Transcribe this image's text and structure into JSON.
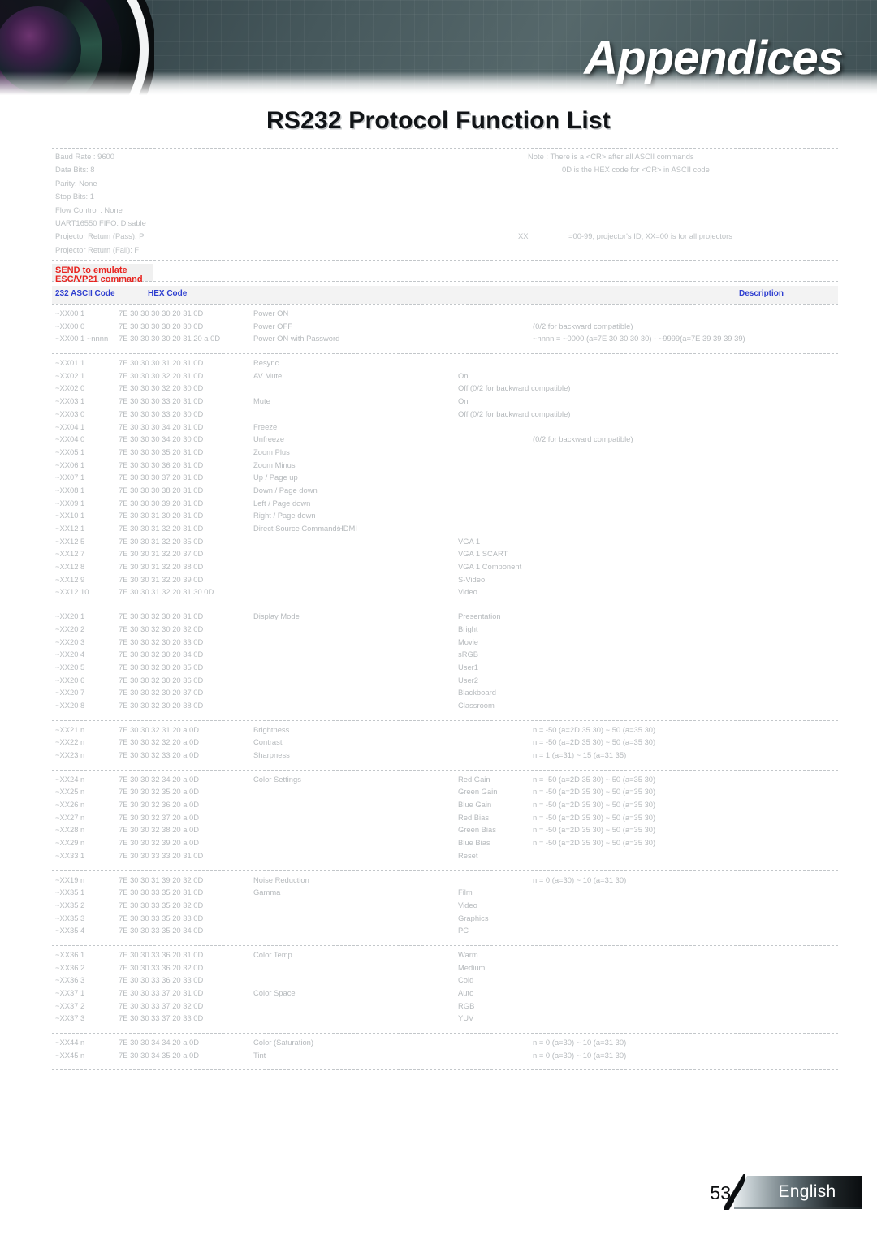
{
  "banner": {
    "title": "Appendices",
    "lens_icon": "camera-lens-icon"
  },
  "page_title": "RS232 Protocol Function List",
  "spec": {
    "labels": [
      "Baud Rate : 9600",
      "Data Bits: 8",
      "Parity: None",
      "Stop Bits: 1",
      "Flow Control : None",
      "UART16550 FIFO: Disable",
      "Projector Return (Pass): P",
      "Projector Return (Fail): F"
    ],
    "note_1": "Note : There is a <CR> after all ASCII commands",
    "note_2": "0D is the HEX code for <CR> in ASCII code",
    "xx_label": "XX",
    "xx_value": "=00-99, projector's ID, XX=00 is for all projectors"
  },
  "red_band": "SEND to emulate ESC/VP21 command",
  "column_header": {
    "a": "232 ASCII Code",
    "b": "HEX Code",
    "c": "Description"
  },
  "groups": [
    {
      "name": "power",
      "rows": [
        {
          "id": "~XX00 1",
          "hex": "7E 30 30 30 30 20 31 0D",
          "fn": "Power ON",
          "fn2": "",
          "val": "",
          "note": "",
          "note2": ""
        },
        {
          "id": "~XX00 0",
          "hex": "7E 30 30 30 30 20 30 0D",
          "fn": "Power OFF",
          "fn2": "",
          "val": "",
          "note": "(0/2 for backward compatible)",
          "note2": ""
        },
        {
          "id": "~XX00 1 ~nnnn",
          "hex": "7E 30 30 30 30 20 31 20 a 0D",
          "fn": "Power ON with Password",
          "fn2": "",
          "val": "",
          "note": "~nnnn = ~0000 (a=7E 30 30 30 30) - ~9999(a=7E 39 39 39 39)",
          "note2": ""
        }
      ]
    },
    {
      "name": "controls",
      "rows": [
        {
          "id": "~XX01 1",
          "hex": "7E 30 30 30 31 20 31 0D",
          "fn": "Resync",
          "fn2": "",
          "val": "",
          "note": "",
          "note2": ""
        },
        {
          "id": "~XX02 1",
          "hex": "7E 30 30 30 32 20 31 0D",
          "fn": "AV Mute",
          "fn2": "",
          "val": "On",
          "note": "",
          "note2": ""
        },
        {
          "id": "~XX02 0",
          "hex": "7E 30 30 30 32 20 30 0D",
          "fn": "",
          "fn2": "",
          "val": "Off (0/2 for backward compatible)",
          "note": "",
          "note2": ""
        },
        {
          "id": "~XX03 1",
          "hex": "7E 30 30 30 33 20 31 0D",
          "fn": "Mute",
          "fn2": "",
          "val": "On",
          "note": "",
          "note2": ""
        },
        {
          "id": "~XX03 0",
          "hex": "7E 30 30 30 33 20 30 0D",
          "fn": "",
          "fn2": "",
          "val": "Off (0/2 for backward compatible)",
          "note": "",
          "note2": ""
        },
        {
          "id": "~XX04 1",
          "hex": "7E 30 30 30 34 20 31 0D",
          "fn": "Freeze",
          "fn2": "",
          "val": "",
          "note": "",
          "note2": ""
        },
        {
          "id": "~XX04 0",
          "hex": "7E 30 30 30 34 20 30 0D",
          "fn": "Unfreeze",
          "fn2": "",
          "val": "",
          "note": "(0/2 for backward compatible)",
          "note2": ""
        },
        {
          "id": "~XX05 1",
          "hex": "7E 30 30 30 35 20 31 0D",
          "fn": "Zoom Plus",
          "fn2": "",
          "val": "",
          "note": "",
          "note2": ""
        },
        {
          "id": "~XX06 1",
          "hex": "7E 30 30 30 36 20 31 0D",
          "fn": "Zoom Minus",
          "fn2": "",
          "val": "",
          "note": "",
          "note2": ""
        },
        {
          "id": "~XX07 1",
          "hex": "7E 30 30 30 37 20 31 0D",
          "fn": "Up / Page up",
          "fn2": "",
          "val": "",
          "note": "",
          "note2": ""
        },
        {
          "id": "~XX08 1",
          "hex": "7E 30 30 30 38 20 31 0D",
          "fn": "Down / Page down",
          "fn2": "",
          "val": "",
          "note": "",
          "note2": ""
        },
        {
          "id": "~XX09 1",
          "hex": "7E 30 30 30 39 20 31 0D",
          "fn": "Left / Page down",
          "fn2": "",
          "val": "",
          "note": "",
          "note2": ""
        },
        {
          "id": "~XX10 1",
          "hex": "7E 30 30 31 30 20 31 0D",
          "fn": "Right / Page down",
          "fn2": "",
          "val": "",
          "note": "",
          "note2": ""
        },
        {
          "id": "~XX12 1",
          "hex": "7E 30 30 31 32 20 31 0D",
          "fn": "Direct Source Commands",
          "fn2": "HDMI",
          "val": "",
          "note": "",
          "note2": ""
        },
        {
          "id": "~XX12 5",
          "hex": "7E 30 30 31 32 20 35 0D",
          "fn": "",
          "fn2": "",
          "val": "VGA 1",
          "note": "",
          "note2": ""
        },
        {
          "id": "~XX12 7",
          "hex": "7E 30 30 31 32 20 37 0D",
          "fn": "",
          "fn2": "",
          "val": "VGA 1 SCART",
          "note": "",
          "note2": ""
        },
        {
          "id": "~XX12 8",
          "hex": "7E 30 30 31 32 20 38 0D",
          "fn": "",
          "fn2": "",
          "val": "VGA 1 Component",
          "note": "",
          "note2": ""
        },
        {
          "id": "~XX12 9",
          "hex": "7E 30 30 31 32 20 39 0D",
          "fn": "",
          "fn2": "",
          "val": "S-Video",
          "note": "",
          "note2": ""
        },
        {
          "id": "~XX12 10",
          "hex": "7E 30 30 31 32 20 31 30 0D",
          "fn": "",
          "fn2": "",
          "val": "Video",
          "note": "",
          "note2": ""
        }
      ]
    },
    {
      "name": "display-mode",
      "rows": [
        {
          "id": "~XX20 1",
          "hex": "7E 30 30 32 30 20 31 0D",
          "fn": "Display Mode",
          "fn2": "",
          "val": "Presentation",
          "note": "",
          "note2": ""
        },
        {
          "id": "~XX20 2",
          "hex": "7E 30 30 32 30 20 32 0D",
          "fn": "",
          "fn2": "",
          "val": "Bright",
          "note": "",
          "note2": ""
        },
        {
          "id": "~XX20 3",
          "hex": "7E 30 30 32 30 20 33 0D",
          "fn": "",
          "fn2": "",
          "val": "Movie",
          "note": "",
          "note2": ""
        },
        {
          "id": "~XX20 4",
          "hex": "7E 30 30 32 30 20 34 0D",
          "fn": "",
          "fn2": "",
          "val": "sRGB",
          "note": "",
          "note2": ""
        },
        {
          "id": "~XX20 5",
          "hex": "7E 30 30 32 30 20 35 0D",
          "fn": "",
          "fn2": "",
          "val": "User1",
          "note": "",
          "note2": ""
        },
        {
          "id": "~XX20 6",
          "hex": "7E 30 30 32 30 20 36 0D",
          "fn": "",
          "fn2": "",
          "val": "User2",
          "note": "",
          "note2": ""
        },
        {
          "id": "~XX20 7",
          "hex": "7E 30 30 32 30 20 37 0D",
          "fn": "",
          "fn2": "",
          "val": "Blackboard",
          "note": "",
          "note2": ""
        },
        {
          "id": "~XX20 8",
          "hex": "7E 30 30 32 30 20 38 0D",
          "fn": "",
          "fn2": "",
          "val": "Classroom",
          "note": "",
          "note2": ""
        }
      ]
    },
    {
      "name": "image-adjust",
      "rows": [
        {
          "id": "~XX21 n",
          "hex": "7E 30 30 32 31 20 a 0D",
          "fn": "Brightness",
          "fn2": "",
          "val": "",
          "note": "n = -50 (a=2D 35 30) ~ 50 (a=35 30)",
          "note2": ""
        },
        {
          "id": "~XX22 n",
          "hex": "7E 30 30 32 32 20 a 0D",
          "fn": "Contrast",
          "fn2": "",
          "val": "",
          "note": "n = -50 (a=2D 35 30) ~ 50 (a=35 30)",
          "note2": ""
        },
        {
          "id": "~XX23 n",
          "hex": "7E 30 30 32 33 20 a 0D",
          "fn": "Sharpness",
          "fn2": "",
          "val": "",
          "note": "n = 1 (a=31) ~ 15 (a=31 35)",
          "note2": ""
        }
      ]
    },
    {
      "name": "color-settings",
      "rows": [
        {
          "id": "~XX24 n",
          "hex": "7E 30 30 32 34 20 a 0D",
          "fn": "Color Settings",
          "fn2": "",
          "val": "Red Gain",
          "note": "n = -50 (a=2D 35 30) ~ 50 (a=35 30)",
          "note2": ""
        },
        {
          "id": "~XX25 n",
          "hex": "7E 30 30 32 35 20 a 0D",
          "fn": "",
          "fn2": "",
          "val": "Green Gain",
          "note": "n = -50 (a=2D 35 30) ~ 50 (a=35 30)",
          "note2": ""
        },
        {
          "id": "~XX26 n",
          "hex": "7E 30 30 32 36 20 a 0D",
          "fn": "",
          "fn2": "",
          "val": "Blue Gain",
          "note": "n = -50 (a=2D 35 30) ~ 50 (a=35 30)",
          "note2": ""
        },
        {
          "id": "~XX27 n",
          "hex": "7E 30 30 32 37 20 a 0D",
          "fn": "",
          "fn2": "",
          "val": "Red Bias",
          "note": "n = -50 (a=2D 35 30) ~ 50 (a=35 30)",
          "note2": ""
        },
        {
          "id": "~XX28 n",
          "hex": "7E 30 30 32 38 20 a 0D",
          "fn": "",
          "fn2": "",
          "val": "Green Bias",
          "note": "n = -50 (a=2D 35 30) ~ 50 (a=35 30)",
          "note2": ""
        },
        {
          "id": "~XX29 n",
          "hex": "7E 30 30 32 39 20 a 0D",
          "fn": "",
          "fn2": "",
          "val": "Blue Bias",
          "note": "n = -50 (a=2D 35 30) ~ 50 (a=35 30)",
          "note2": ""
        },
        {
          "id": "~XX33 1",
          "hex": "7E 30 30 33 33 20 31 0D",
          "fn": "",
          "fn2": "",
          "val": "Reset",
          "note": "",
          "note2": ""
        }
      ]
    },
    {
      "name": "gamma",
      "rows": [
        {
          "id": "~XX19 n",
          "hex": "7E 30 30 31 39 20 32 0D",
          "fn": "Noise Reduction",
          "fn2": "",
          "val": "",
          "note": "n = 0 (a=30) ~ 10 (a=31 30)",
          "note2": ""
        },
        {
          "id": "~XX35 1",
          "hex": "7E 30 30 33 35 20 31 0D",
          "fn": "Gamma",
          "fn2": "",
          "val": "Film",
          "note": "",
          "note2": ""
        },
        {
          "id": "~XX35 2",
          "hex": "7E 30 30 33 35 20 32 0D",
          "fn": "",
          "fn2": "",
          "val": "Video",
          "note": "",
          "note2": ""
        },
        {
          "id": "~XX35 3",
          "hex": "7E 30 30 33 35 20 33 0D",
          "fn": "",
          "fn2": "",
          "val": "Graphics",
          "note": "",
          "note2": ""
        },
        {
          "id": "~XX35 4",
          "hex": "7E 30 30 33 35 20 34 0D",
          "fn": "",
          "fn2": "",
          "val": "PC",
          "note": "",
          "note2": ""
        }
      ]
    },
    {
      "name": "color-temp-space",
      "rows": [
        {
          "id": "~XX36 1",
          "hex": "7E 30 30 33 36 20 31 0D",
          "fn": "Color Temp.",
          "fn2": "",
          "val": "Warm",
          "note": "",
          "note2": ""
        },
        {
          "id": "~XX36 2",
          "hex": "7E 30 30 33 36 20 32 0D",
          "fn": "",
          "fn2": "",
          "val": "Medium",
          "note": "",
          "note2": ""
        },
        {
          "id": "~XX36 3",
          "hex": "7E 30 30 33 36 20 33 0D",
          "fn": "",
          "fn2": "",
          "val": "Cold",
          "note": "",
          "note2": ""
        },
        {
          "id": "~XX37 1",
          "hex": "7E 30 30 33 37 20 31 0D",
          "fn": "Color Space",
          "fn2": "",
          "val": "Auto",
          "note": "",
          "note2": ""
        },
        {
          "id": "~XX37 2",
          "hex": "7E 30 30 33 37 20 32 0D",
          "fn": "",
          "fn2": "",
          "val": "RGB",
          "note": "",
          "note2": ""
        },
        {
          "id": "~XX37 3",
          "hex": "7E 30 30 33 37 20 33 0D",
          "fn": "",
          "fn2": "",
          "val": "YUV",
          "note": "",
          "note2": ""
        }
      ]
    },
    {
      "name": "color-space-threshold",
      "rows": [
        {
          "id": "~XX44 n",
          "hex": "7E 30 30 34 34 20 a 0D",
          "fn": "Color (Saturation)",
          "fn2": "",
          "val": "",
          "note": "n = 0 (a=30) ~ 10 (a=31 30)",
          "note2": ""
        },
        {
          "id": "~XX45 n",
          "hex": "7E 30 30 34 35 20 a 0D",
          "fn": "Tint",
          "fn2": "",
          "val": "",
          "note": "n = 0 (a=30) ~ 10 (a=31 30)",
          "note2": ""
        }
      ]
    }
  ],
  "footer": {
    "page_number": "53",
    "language": "English"
  },
  "colors": {
    "accent_red": "#e8231f",
    "accent_blue": "#2f3fd0",
    "banner_dark": "#3f5054",
    "text_faded": "#b6babd"
  }
}
